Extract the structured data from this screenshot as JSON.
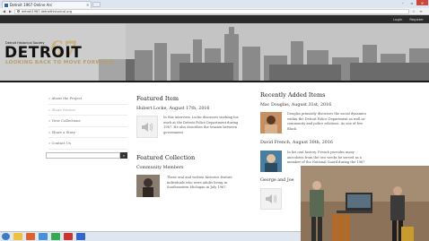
{
  "browser": {
    "tab_title": "Detroit 1967 Online Arc",
    "tab_close": "×",
    "url": "detroit1967.detroithistorical.org",
    "back_icon": "◀",
    "forward_icon": "▶",
    "menu_icon": "≡",
    "window_min": "–",
    "window_max": "▫",
    "window_close": "✕"
  },
  "site_bar": {
    "login": "Login",
    "register": "Register"
  },
  "banner": {
    "org": "Detroit Historical Society",
    "logo": "DETROIT",
    "year": "67",
    "tagline": "LOOKING BACK TO MOVE FORWARD"
  },
  "sidebar": {
    "items": [
      {
        "label": "» About the Project"
      },
      {
        "label": "» Share Stories"
      },
      {
        "label": "» View Collections"
      },
      {
        "label": "» Share a Story"
      },
      {
        "label": "» Contact Us"
      }
    ],
    "search_button": "⌕"
  },
  "featured_item": {
    "heading": "Featured Item",
    "title": "Hubert Locke, August 17th, 2016",
    "description": "In this interview, Locke discusses working his work at the Detroit Police Department during 1967. He also describes the tension between government"
  },
  "featured_collection": {
    "heading": "Featured Collection",
    "title": "Community Members",
    "description": "These oral and written histories feature individuals who were adults living in Southeastern Michigan in July 1967."
  },
  "recent": {
    "heading": "Recently Added Items",
    "items": [
      {
        "title": "Mac Douglas, August 31st, 2016",
        "description": "Douglas primarily discusses the social dynamics within the Detroit Police Department as well as community and police relations. As one of few Black"
      },
      {
        "title": "David French, August 30th, 2016",
        "description": "In his oral history, French provides many anecdotes from the two weeks he served as a member of the National Guard during the 1967 unrest. He recalls"
      },
      {
        "title": "George and Joe"
      }
    ]
  },
  "colors": {
    "site_bar": "#2b2b2b",
    "logo_gold": "#b8a066",
    "taskbar": "#dfe6ee"
  }
}
